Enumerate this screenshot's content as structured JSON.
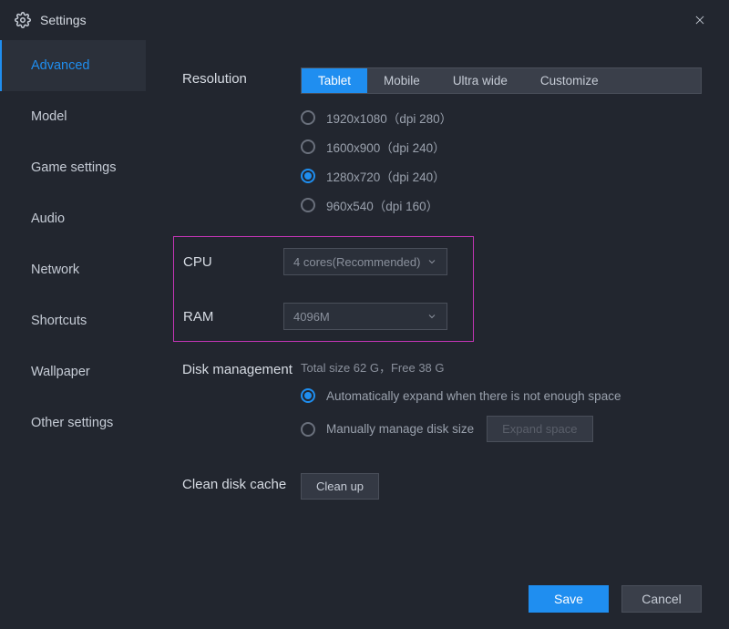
{
  "window": {
    "title": "Settings"
  },
  "sidebar": {
    "items": [
      {
        "label": "Advanced",
        "active": true
      },
      {
        "label": "Model",
        "active": false
      },
      {
        "label": "Game settings",
        "active": false
      },
      {
        "label": "Audio",
        "active": false
      },
      {
        "label": "Network",
        "active": false
      },
      {
        "label": "Shortcuts",
        "active": false
      },
      {
        "label": "Wallpaper",
        "active": false
      },
      {
        "label": "Other settings",
        "active": false
      }
    ]
  },
  "resolution": {
    "label": "Resolution",
    "segments": [
      {
        "label": "Tablet",
        "active": true
      },
      {
        "label": "Mobile",
        "active": false
      },
      {
        "label": "Ultra wide",
        "active": false
      },
      {
        "label": "Customize",
        "active": false
      }
    ],
    "options": [
      {
        "label": "1920x1080（dpi 280）",
        "checked": false
      },
      {
        "label": "1600x900（dpi 240）",
        "checked": false
      },
      {
        "label": "1280x720（dpi 240）",
        "checked": true
      },
      {
        "label": "960x540（dpi 160）",
        "checked": false
      }
    ]
  },
  "cpu": {
    "label": "CPU",
    "value": "4 cores(Recommended)"
  },
  "ram": {
    "label": "RAM",
    "value": "4096M"
  },
  "disk": {
    "label": "Disk management",
    "info": "Total size 62 G，Free 38 G",
    "options": [
      {
        "label": "Automatically expand when there is not enough space",
        "checked": true
      },
      {
        "label": "Manually manage disk size",
        "checked": false
      }
    ],
    "expand_label": "Expand space"
  },
  "cache": {
    "label": "Clean disk cache",
    "button_label": "Clean up"
  },
  "footer": {
    "save": "Save",
    "cancel": "Cancel"
  }
}
